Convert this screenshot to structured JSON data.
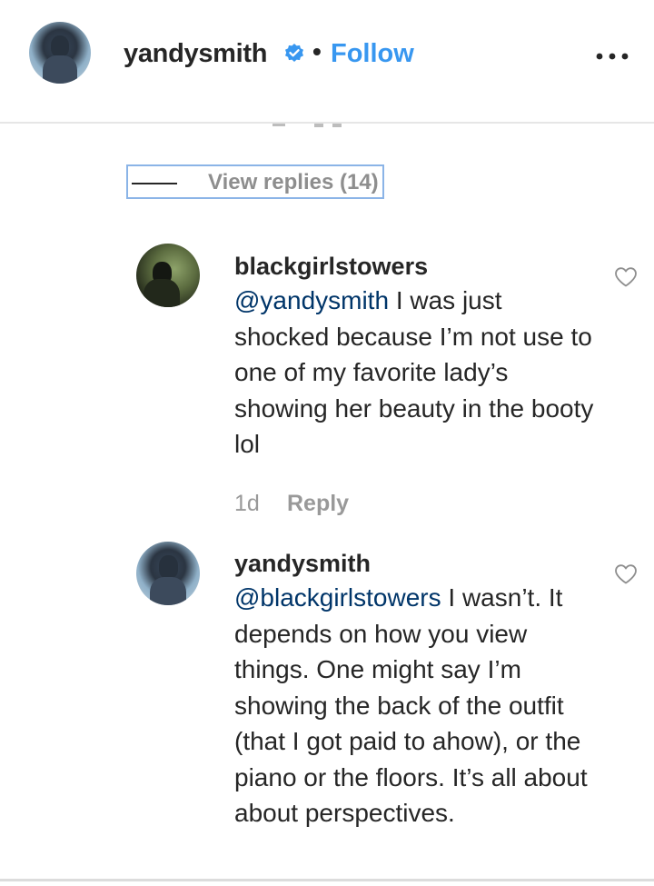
{
  "header": {
    "username": "yandysmith",
    "verified_icon": "verified-badge-icon",
    "separator": "•",
    "follow_label": "Follow",
    "more_icon": "more-options-icon",
    "accent_color": "#3897f0",
    "verified_color": "#3897f0"
  },
  "thread": {
    "view_replies_label": "View replies (14)"
  },
  "comments": [
    {
      "username": "blackgirlstowers",
      "mention": "@yandysmith",
      "text": " I was just shocked because I’m not use to one of my favorite lady’s showing her beauty in the booty lol",
      "timestamp": "1d",
      "reply_label": "Reply",
      "like_icon": "heart-outline-icon"
    },
    {
      "username": "yandysmith",
      "mention": "@blackgirlstowers",
      "text": " I wasn’t. It depends on how you view things. One might say I’m showing the back of the outfit (that I got paid to ahow), or the piano or the floors. It’s all about about perspectives.",
      "like_icon": "heart-outline-icon"
    }
  ],
  "colors": {
    "text": "#262626",
    "muted": "#999999",
    "mention": "#003569",
    "link": "#3897f0"
  }
}
